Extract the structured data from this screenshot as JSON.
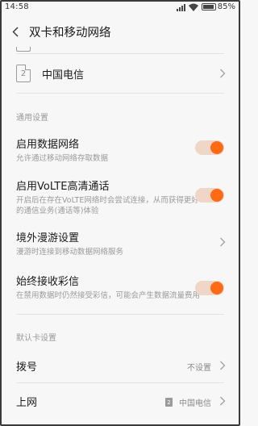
{
  "status_bar": {
    "time": "14:58",
    "battery": "85%",
    "battery_level": 0.85
  },
  "header": {
    "title": "双卡和移动网络"
  },
  "sim2": {
    "slot_number": "2",
    "label": "中国电信"
  },
  "general_section": {
    "header": "通用设置",
    "items": [
      {
        "title": "启用数据网络",
        "subtitle": "允许通过移动网络存取数据",
        "enabled": true
      },
      {
        "title": "启用VoLTE高清通话",
        "subtitle": "开启后在存在VoLTE网络时会尝试连接，从而获得更好的通信业务(通话等)体验",
        "enabled": true
      },
      {
        "title": "境外漫游设置",
        "subtitle": "漫游时连接到移动数据网络服务"
      },
      {
        "title": "始终接收彩信",
        "subtitle": "在禁用数据时仍然接受彩信，可能会产生数据流量费用",
        "enabled": true
      }
    ]
  },
  "default_section": {
    "header": "默认卡设置",
    "items": [
      {
        "title": "拨号",
        "value": "不设置"
      },
      {
        "title": "上网",
        "value": "中国电信",
        "sim_badge": "2"
      }
    ]
  },
  "colors": {
    "accent": "#ff6a14",
    "background": "#f7f7f7",
    "divider": "#e3e3e3"
  }
}
